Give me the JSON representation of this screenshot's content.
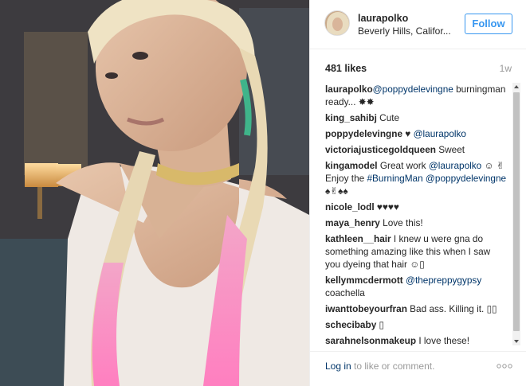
{
  "post": {
    "username": "laurapolko",
    "location": "Beverly Hills, Califor...",
    "follow_label": "Follow",
    "likes": "481 likes",
    "age": "1w"
  },
  "comments": [
    {
      "author": "laurapolko",
      "parts": [
        {
          "t": "mention",
          "v": "@poppydelevingne"
        },
        {
          "t": "text",
          "v": " burningman ready... ✸✸"
        }
      ]
    },
    {
      "author": "king_sahibj",
      "parts": [
        {
          "t": "text",
          "v": " Cute"
        }
      ]
    },
    {
      "author": "poppydelevingne",
      "parts": [
        {
          "t": "text",
          "v": " ♥ "
        },
        {
          "t": "mention",
          "v": "@laurapolko"
        }
      ]
    },
    {
      "author": "victoriajusticegoldqueen",
      "parts": [
        {
          "t": "text",
          "v": " Sweet"
        }
      ]
    },
    {
      "author": "kingamodel",
      "parts": [
        {
          "t": "text",
          "v": " Great work "
        },
        {
          "t": "mention",
          "v": "@laurapolko"
        },
        {
          "t": "text",
          "v": " ☺ ✌ Enjoy the "
        },
        {
          "t": "mention",
          "v": "#BurningMan"
        },
        {
          "t": "text",
          "v": " "
        },
        {
          "t": "mention",
          "v": "@poppydelevingne"
        },
        {
          "t": "text",
          "v": " ♠✌♠♠"
        }
      ]
    },
    {
      "author": "nicole_lodl",
      "parts": [
        {
          "t": "text",
          "v": " ♥♥♥♥"
        }
      ]
    },
    {
      "author": "maya_henry",
      "parts": [
        {
          "t": "text",
          "v": " Love this!"
        }
      ]
    },
    {
      "author": "kathleen__hair",
      "parts": [
        {
          "t": "text",
          "v": " I knew u were gna do something amazing like this when I saw you dyeing that hair ☺▯"
        }
      ]
    },
    {
      "author": "kellymmcdermott",
      "parts": [
        {
          "t": "text",
          "v": " "
        },
        {
          "t": "mention",
          "v": "@thepreppygypsy"
        },
        {
          "t": "text",
          "v": " coachella"
        }
      ]
    },
    {
      "author": "iwanttobeyourfran",
      "parts": [
        {
          "t": "text",
          "v": " Bad ass. Killing it. ▯▯"
        }
      ]
    },
    {
      "author": "schecibaby",
      "parts": [
        {
          "t": "text",
          "v": " ▯"
        }
      ]
    },
    {
      "author": "sarahnelsonmakeup",
      "parts": [
        {
          "t": "text",
          "v": " I love these!"
        }
      ]
    }
  ],
  "footer": {
    "login_link": "Log in",
    "login_rest": " to like or comment.",
    "more_icon": "more-options-icon"
  },
  "colors": {
    "accent": "#3897f0",
    "link": "#003569",
    "muted": "#999999"
  },
  "icons": {
    "scroll_up": "scroll-up-arrow-icon",
    "scroll_down": "scroll-down-arrow-icon"
  }
}
